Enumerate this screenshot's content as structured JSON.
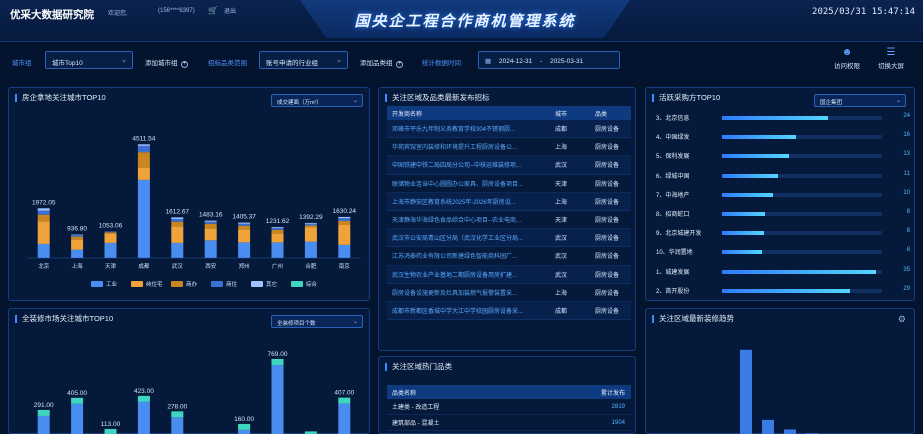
{
  "header": {
    "logo": "优采大数据研究院",
    "welcome": "欢迎您,",
    "phone": "(156****6397)",
    "exit": "退出",
    "title": "国央企工程合作商机管理系统",
    "datetime": "2025/03/31 15:47:14"
  },
  "filters": {
    "city_group_label": "城市组",
    "city_select": "城市Top10",
    "add_city_group": "添加城市组",
    "bid_scope_label": "招标品类范围",
    "bid_scope_select": "账号申请的行业组",
    "add_category_group": "添加品类组",
    "stats_time_label": "统计数据时间",
    "date_start": "2024-12-31",
    "date_sep": "-",
    "date_end": "2025-03-31",
    "visit_permission": "访问权限",
    "switch_screen": "切换大屏"
  },
  "panel_land": {
    "title": "房企拿地关注城市TOP10",
    "select": "成交建面（万m²）"
  },
  "chart_land": {
    "type": "bar",
    "categories": [
      "北京",
      "上海",
      "天津",
      "成都",
      "武汉",
      "西安",
      "郑州",
      "广州",
      "合肥",
      "南京"
    ],
    "totals": [
      "1972.05",
      "936.80",
      "1053.06",
      "4511.54",
      "1612.67",
      "1483.16",
      "1405.37",
      "1231.62",
      "1392.29",
      "1630.24"
    ],
    "series": [
      {
        "name": "工业",
        "color": "#4a8df0",
        "values": [
          560,
          330,
          600,
          3100,
          600,
          700,
          620,
          620,
          650,
          520
        ]
      },
      {
        "name": "纯住宅",
        "color": "#f0a33a",
        "values": [
          900,
          400,
          380,
          500,
          660,
          480,
          520,
          360,
          560,
          790
        ]
      },
      {
        "name": "商办",
        "color": "#c9851f",
        "values": [
          260,
          120,
          40,
          600,
          180,
          180,
          140,
          140,
          80,
          160
        ]
      },
      {
        "name": "商住",
        "color": "#3b6fd0",
        "values": [
          160,
          70,
          30,
          250,
          110,
          80,
          80,
          80,
          70,
          110
        ]
      },
      {
        "name": "其它",
        "color": "#9fc3ff",
        "values": [
          92.05,
          16.8,
          3.06,
          61.54,
          62.67,
          43.16,
          45.37,
          31.62,
          32.29,
          50.24
        ]
      },
      {
        "name": "综合",
        "color": "#3fd6c0",
        "values": [
          0,
          0,
          0,
          0,
          0,
          0,
          0,
          0,
          0,
          0
        ]
      }
    ],
    "ylim": [
      0,
      5000
    ]
  },
  "panel_reno": {
    "title": "全装修市场关注城市TOP10",
    "select": "全装修项目个数"
  },
  "chart_reno": {
    "type": "bar",
    "totals": [
      "291.00",
      "405.00",
      "113.00",
      "423.00",
      "278.00",
      "",
      "160.00",
      "769.00",
      "",
      "407.00"
    ],
    "values": [
      291,
      405,
      113,
      423,
      278,
      60,
      160,
      769,
      90,
      407
    ],
    "ylim": [
      0,
      900
    ]
  },
  "panel_bids": {
    "title": "关注区域及品类最新发布招标",
    "headers": [
      "开发商名称",
      "城市",
      "品类"
    ],
    "rows": [
      [
        "邓峰市平乐九年制义务教育学校304不锈钢厨...",
        "成都",
        "厨房设备"
      ],
      [
        "华苑宾馆室内装修和环境提升工程厨房设备公...",
        "上海",
        "厨房设备"
      ],
      [
        "中国铁建中铁二局四局分公司--中核运维装修项...",
        "武汉",
        "厨房设备"
      ],
      [
        "联储物业连当中心圆圆办公家具、厨房设备项目...",
        "天津",
        "厨房设备"
      ],
      [
        "上海市静安区教育系统2025年-2026年厨房设...",
        "上海",
        "厨房设备"
      ],
      [
        "天津静海华海绿色食品综合中心项目--农业电商...",
        "天津",
        "厨房设备"
      ],
      [
        "武汉市公安局青山区分局（武汉化学工业区分局...",
        "武汉",
        "厨房设备"
      ],
      [
        "江苏鸿泰药业有限公司新建绿色智能商科园厂...",
        "武汉",
        "厨房设备"
      ],
      [
        "武汉生物农业产业基地二期厨房设备用房扩建...",
        "武汉",
        "厨房设备"
      ],
      [
        "厨房设备设施更新及灶具加装燃气报警装置采...",
        "上海",
        "厨房设备"
      ],
      [
        "成都市新都区香城中学大江中学校园厨房设备采...",
        "成都",
        "厨房设备"
      ]
    ]
  },
  "panel_hot": {
    "title": "关注区域热门品类",
    "headers": [
      "品类名称",
      "累计发布"
    ],
    "rows": [
      [
        "土建类 - 改造工程",
        "2819"
      ],
      [
        "建筑部品 - 混凝土",
        "1904"
      ]
    ]
  },
  "panel_buyers": {
    "title": "活跃采购方TOP10",
    "select": "国企集团",
    "rows": [
      {
        "rank": "3、北京信息",
        "count": "24",
        "frac": 0.66
      },
      {
        "rank": "4、中国绿发",
        "count": "16",
        "frac": 0.46
      },
      {
        "rank": "5、保利发展",
        "count": "13",
        "frac": 0.42
      },
      {
        "rank": "6、绿城中国",
        "count": "11",
        "frac": 0.35
      },
      {
        "rank": "7、中海地产",
        "count": "10",
        "frac": 0.32
      },
      {
        "rank": "8、招商蛇口",
        "count": "8",
        "frac": 0.27
      },
      {
        "rank": "9、北京城建开发",
        "count": "8",
        "frac": 0.26
      },
      {
        "rank": "10、华润置地",
        "count": "8",
        "frac": 0.25
      },
      {
        "rank": "1、城建发展",
        "count": "35",
        "frac": 0.96
      },
      {
        "rank": "2、首开股份",
        "count": "29",
        "frac": 0.8
      }
    ]
  },
  "panel_trend": {
    "title": "关注区域最新装修趋势",
    "values": [
      0.95,
      0.22,
      0.12,
      0.08
    ]
  }
}
